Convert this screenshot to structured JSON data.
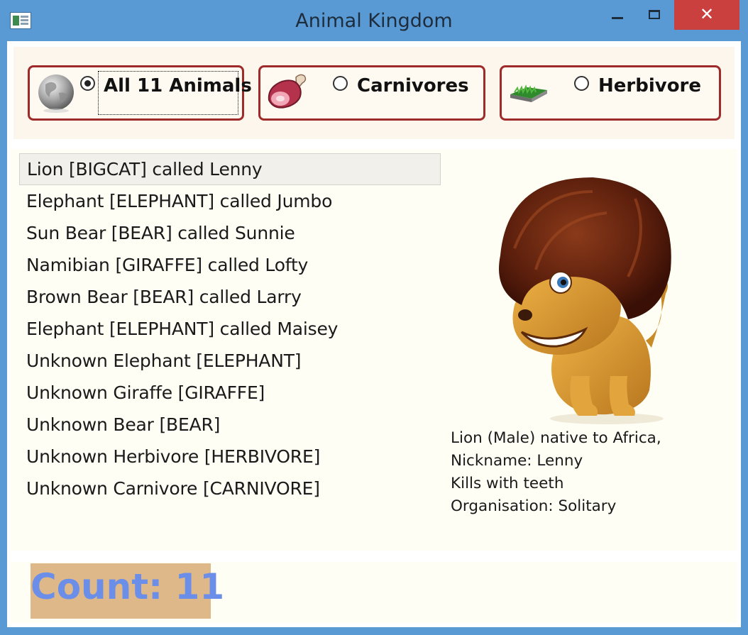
{
  "window": {
    "title": "Animal Kingdom",
    "close_glyph": "✕"
  },
  "filters": [
    {
      "label": "All 11 Animals",
      "icon": "globe-icon",
      "selected": true
    },
    {
      "label": "Carnivores",
      "icon": "meat-icon",
      "selected": false
    },
    {
      "label": "Herbivore",
      "icon": "grass-icon",
      "selected": false
    }
  ],
  "animals": [
    "Lion [BIGCAT] called Lenny",
    "Elephant [ELEPHANT] called Jumbo",
    "Sun Bear [BEAR] called Sunnie",
    "Namibian [GIRAFFE] called Lofty",
    "Brown Bear [BEAR] called Larry",
    "Elephant [ELEPHANT] called Maisey",
    "Unknown Elephant [ELEPHANT]",
    "Unknown Giraffe [GIRAFFE]",
    "Unknown Bear [BEAR]",
    "Unknown Herbivore [HERBIVORE]",
    "Unknown Carnivore [CARNIVORE]"
  ],
  "selected_index": 0,
  "details": [
    "Lion (Male) native to Africa,",
    "Nickname: Lenny",
    "Kills with teeth",
    "Organisation: Solitary"
  ],
  "count_text": "Count: 11",
  "colors": {
    "accent_border": "#9e2b2a",
    "count_text": "#6b8ee8",
    "count_background": "#dfb88a",
    "titlebar": "#5a9ad4",
    "close_button": "#c9403f"
  }
}
